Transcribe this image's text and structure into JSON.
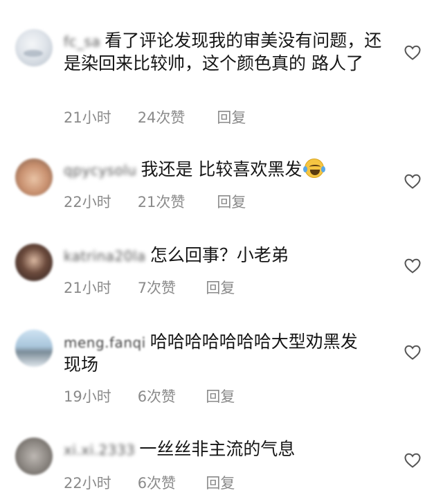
{
  "comments": [
    {
      "username": "fc_sa",
      "text": "看了评论发现我的审美没有问题，还是染回来比较帅，这个颜色真的 路人了",
      "time": "21小时",
      "likes": "24次赞",
      "reply": "回复",
      "icons": {
        "avatar": "avatar-image",
        "like": "heart-outline-icon"
      }
    },
    {
      "username": "qpycysolu",
      "text": "我还是 比较喜欢黑发",
      "emoji": "face-with-tears-of-joy-emoji",
      "time": "22小时",
      "likes": "21次赞",
      "reply": "回复",
      "icons": {
        "avatar": "avatar-image",
        "like": "heart-outline-icon"
      }
    },
    {
      "username": "katrina20la",
      "text": "怎么回事？小老弟",
      "time": "21小时",
      "likes": "7次赞",
      "reply": "回复",
      "icons": {
        "avatar": "avatar-image",
        "like": "heart-outline-icon"
      }
    },
    {
      "username": "meng.fanqi",
      "text": "哈哈哈哈哈哈哈大型劝黑发现场",
      "time": "19小时",
      "likes": "6次赞",
      "reply": "回复",
      "icons": {
        "avatar": "avatar-image",
        "like": "heart-outline-icon"
      }
    },
    {
      "username": "xi.xi.2333",
      "text": "一丝丝非主流的气息",
      "time": "22小时",
      "likes": "6次赞",
      "reply": "回复",
      "icons": {
        "avatar": "avatar-image",
        "like": "heart-outline-icon"
      }
    }
  ],
  "colors": {
    "text": "#151515",
    "meta": "#8a8a8a",
    "heart_stroke": "#555555",
    "background": "#ffffff"
  }
}
